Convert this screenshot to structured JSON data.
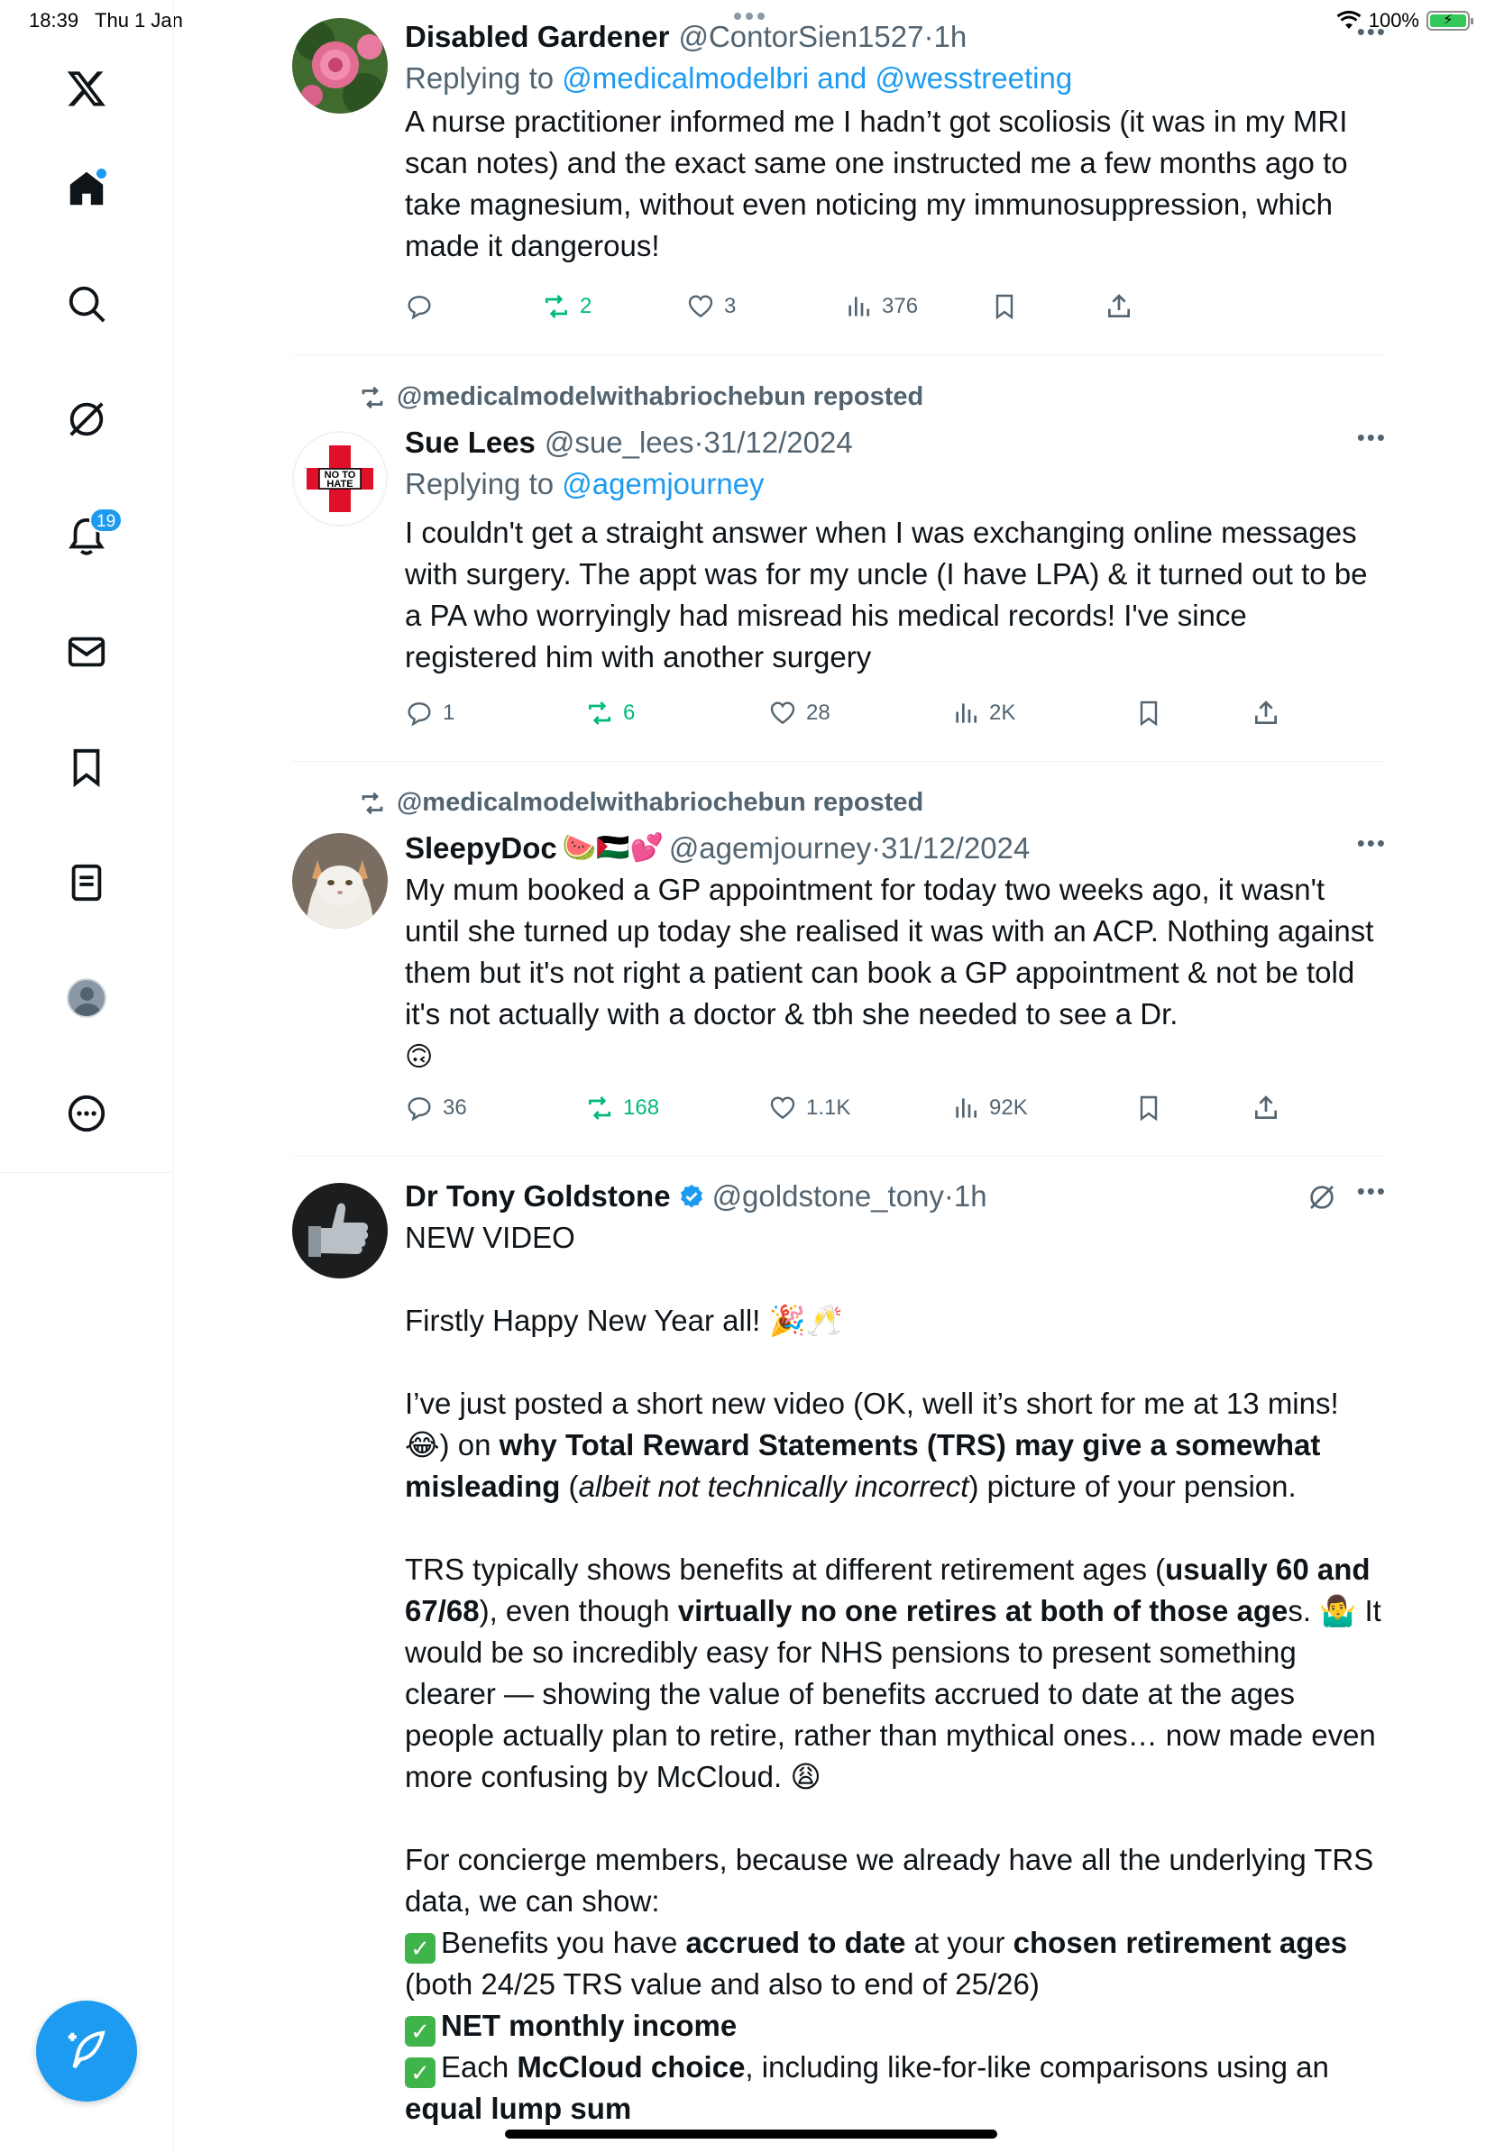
{
  "status_bar": {
    "time": "18:39",
    "date": "Thu 1 Jan",
    "battery": "100%",
    "battery_level": 1.0
  },
  "sidebar": {
    "logo": "x-logo-icon",
    "items": [
      {
        "icon": "home-icon",
        "has_dot": true
      },
      {
        "icon": "search-icon"
      },
      {
        "icon": "grok-icon"
      },
      {
        "icon": "bell-icon",
        "badge": "19"
      },
      {
        "icon": "mail-icon"
      },
      {
        "icon": "bookmark-icon"
      },
      {
        "icon": "list-icon"
      },
      {
        "icon": "profile-icon"
      },
      {
        "icon": "more-icon"
      }
    ],
    "compose_icon": "compose-icon"
  },
  "posts": [
    {
      "name": "Disabled Gardener",
      "handle": "@ContorSien1527",
      "time": "1h",
      "reply_prefix": "Replying to",
      "reply_to": "@medicalmodelbri and @wesstreeting",
      "text": "A nurse practitioner informed me I hadn’t got scoliosis (it was in my MRI scan notes) and the exact same one instructed me a few months ago to take magnesium, without even noticing my immunosuppression, which made it dangerous!",
      "stats": {
        "replies": "",
        "reposts": "2",
        "likes": "3",
        "views": "376"
      }
    },
    {
      "repost_label": "@medicalmodelwithabriochebun reposted",
      "name": "Sue Lees",
      "handle": "@sue_lees",
      "time": "31/12/2024",
      "reply_prefix": "Replying to",
      "reply_to": "@agemjourney",
      "text": "I couldn't get a straight answer when I was exchanging online messages with surgery. The appt was for my uncle (I have LPA) & it turned out to be a PA who worryingly had misread his medical records! I've since registered him with another surgery",
      "avatar_text": "NO TO HATE",
      "stats": {
        "replies": "1",
        "reposts": "6",
        "likes": "28",
        "views": "2K"
      }
    },
    {
      "repost_label": "@medicalmodelwithabriochebun reposted",
      "name": "SleepyDoc",
      "name_emojis": "🍉🇵🇸💕",
      "handle": "@agemjourney",
      "time": "31/12/2024",
      "text": "My mum booked a GP appointment for today two weeks ago, it wasn't until she turned up today she realised it was with an ACP. Nothing against them but it's not right a patient can book a GP appointment  & not be told it's not actually with a doctor & tbh she needed to see a Dr.",
      "text_emoji": "🙃",
      "stats": {
        "replies": "36",
        "reposts": "168",
        "likes": "1.1K",
        "views": "92K"
      }
    },
    {
      "name": "Dr Tony Goldstone",
      "handle": "@goldstone_tony",
      "time": "1h",
      "paragraphs": {
        "p1": "NEW VIDEO",
        "p2": "Firstly Happy New Year all! 🎉🥂",
        "p3a": "I’ve just posted a short new video (OK, well it’s short for me at 13 mins! 😂) on ",
        "p3b": "why Total Reward Statements (TRS) may give a somewhat misleading",
        "p3c": " (",
        "p3d": "albeit not technically incorrect",
        "p3e": ") picture of your pension.",
        "p4a": "TRS typically shows benefits at different retirement ages (",
        "p4b": "usually 60 and 67/68",
        "p4c": "), even though ",
        "p4d": "virtually no one retires at both of those age",
        "p4e": "s. 🤷‍♂️ It would be so incredibly easy for NHS pensions to present something clearer — showing the value of benefits accrued to date at the ages people actually plan to retire, rather than mythical ones… now made even more confusing by McCloud. 😩",
        "p5": "For concierge members, because we already have all the underlying TRS data, we can show:",
        "b1a": "Benefits you have ",
        "b1b": "accrued to date",
        "b1c": " at your ",
        "b1d": "chosen retirement ages",
        "b1e": " (both 24/25 TRS value and also to end of 25/26)",
        "b2": "NET monthly income",
        "b3a": "Each ",
        "b3b": "McCloud choice",
        "b3c": ", including like-for-like comparisons using an ",
        "b3d": "equal lump sum"
      }
    }
  ],
  "colors": {
    "accent": "#1d9bf0",
    "repost_green": "#00ba7c",
    "muted": "#536471",
    "text": "#0f1419",
    "divider": "#eff3f4"
  }
}
